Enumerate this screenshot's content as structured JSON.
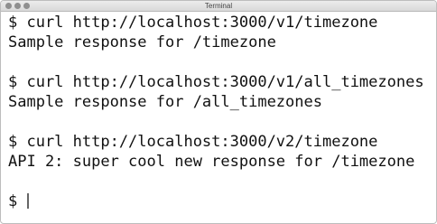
{
  "window": {
    "title": "Terminal"
  },
  "terminal": {
    "lines": [
      "$ curl http://localhost:3000/v1/timezone",
      "Sample response for /timezone",
      "",
      "$ curl http://localhost:3000/v1/all_timezones",
      "Sample response for /all_timezones",
      "",
      "$ curl http://localhost:3000/v2/timezone",
      "API 2: super cool new response for /timezone",
      ""
    ],
    "prompt": "$ "
  },
  "colors": {
    "text": "#111111",
    "background": "#ffffff",
    "titlebar": "#e2e2e2"
  }
}
